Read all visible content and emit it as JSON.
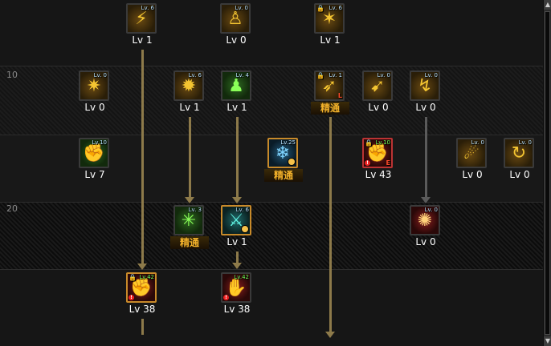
{
  "row_labels": {
    "row_10": "10",
    "row_20": "20"
  },
  "skills": [
    {
      "id": "s1",
      "icon": "gold-slash-icon",
      "glyph": "⚡",
      "tag": "Lv. 6",
      "label": "Lv 1"
    },
    {
      "id": "s2",
      "icon": "gold-figure-icon",
      "glyph": "♙",
      "tag": "Lv. 0",
      "label": "Lv 0"
    },
    {
      "id": "s3",
      "icon": "gold-burst-icon",
      "glyph": "✶",
      "tag": "Lv. 6",
      "label": "Lv 1"
    },
    {
      "id": "s4",
      "icon": "gold-spark-icon",
      "glyph": "✷",
      "tag": "Lv. 0",
      "label": "Lv 0"
    },
    {
      "id": "s5",
      "icon": "gold-explosion-icon",
      "glyph": "✹",
      "tag": "Lv. 6",
      "label": "Lv 1"
    },
    {
      "id": "s6",
      "icon": "green-body-icon",
      "glyph": "♟",
      "tag": "Lv. 4",
      "label": "Lv 1"
    },
    {
      "id": "s7",
      "icon": "gold-running-icon",
      "glyph": "➶",
      "tag": "Lv. 1",
      "mark": "L",
      "mastery": "精通"
    },
    {
      "id": "s8",
      "icon": "gold-rush-icon",
      "glyph": "➹",
      "tag": "Lv. 0",
      "label": "Lv 0"
    },
    {
      "id": "s9",
      "icon": "gold-strike-icon",
      "glyph": "↯",
      "tag": "Lv. 0",
      "label": "Lv 0"
    },
    {
      "id": "s10",
      "icon": "green-fist-icon",
      "glyph": "✊",
      "tag": "Lv.10",
      "label": "Lv 7"
    },
    {
      "id": "s11",
      "icon": "blue-aura-icon",
      "glyph": "❄",
      "tag": "Lv.25",
      "mastery": "精通"
    },
    {
      "id": "s12",
      "icon": "red-fury-icon",
      "glyph": "✊",
      "tag": "Lv.10",
      "mark": "E",
      "label": "Lv 43"
    },
    {
      "id": "s13",
      "icon": "gold-fireball-icon",
      "glyph": "☄",
      "tag": "Lv. 0",
      "label": "Lv 0"
    },
    {
      "id": "s14",
      "icon": "gold-spiral-icon",
      "glyph": "↻",
      "tag": "Lv. 0",
      "label": "Lv 0"
    },
    {
      "id": "s15",
      "icon": "green-shock-icon",
      "glyph": "✳",
      "tag": "Lv. 3",
      "mastery": "精通"
    },
    {
      "id": "s16",
      "icon": "teal-figure-icon",
      "glyph": "⚔",
      "tag": "Lv. 6",
      "label": "Lv 1"
    },
    {
      "id": "s17",
      "icon": "red-whirl-icon",
      "glyph": "✺",
      "tag": "Lv. 0",
      "label": "Lv 0"
    },
    {
      "id": "s18",
      "icon": "red-rage-icon",
      "glyph": "✊",
      "tag": "Lv.42",
      "label": "Lv 38"
    },
    {
      "id": "s19",
      "icon": "red-punch-icon",
      "glyph": "✋",
      "tag": "Lv.42",
      "label": "Lv 38"
    }
  ],
  "scrollbar": {
    "up_glyph": "▲",
    "down_glyph": "▼"
  },
  "colors": {
    "connector": "#8d7a4a",
    "connector_locked": "#5a5a5a",
    "mastery": "#f2b12a",
    "frame_active": "#c88a2a"
  }
}
